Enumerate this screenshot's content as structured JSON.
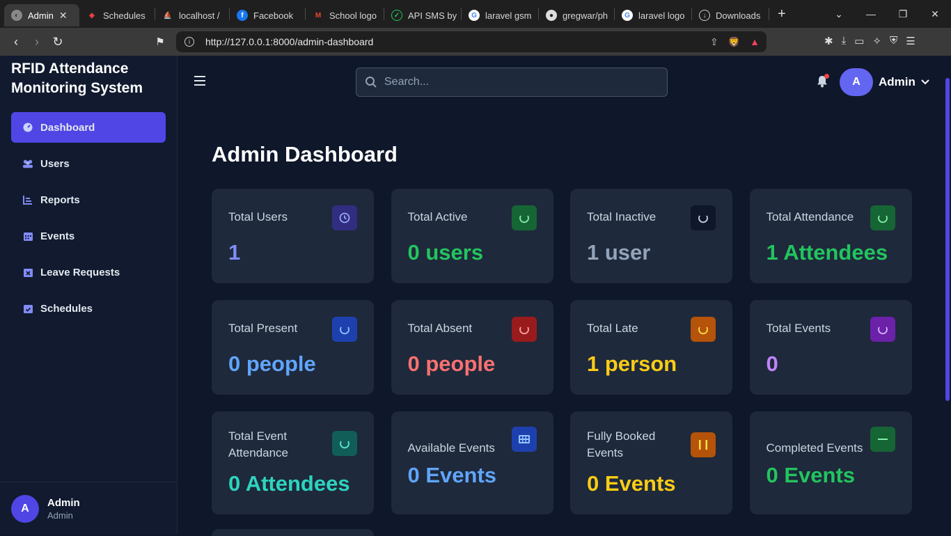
{
  "browser": {
    "tabs": [
      {
        "label": "Admin",
        "active": true
      },
      {
        "label": "Schedules"
      },
      {
        "label": "localhost / "
      },
      {
        "label": "Facebook"
      },
      {
        "label": "School logo"
      },
      {
        "label": "API SMS by"
      },
      {
        "label": "laravel gsm"
      },
      {
        "label": "gregwar/ph"
      },
      {
        "label": "laravel logo"
      },
      {
        "label": "Downloads"
      }
    ],
    "url": "http://127.0.0.1:8000/admin-dashboard"
  },
  "sidebar": {
    "brand": "RFID Attendance Monitoring System",
    "items": [
      {
        "label": "Dashboard",
        "active": true
      },
      {
        "label": "Users"
      },
      {
        "label": "Reports"
      },
      {
        "label": "Events"
      },
      {
        "label": "Leave Requests"
      },
      {
        "label": "Schedules"
      }
    ],
    "footer": {
      "avatar_initial": "A",
      "name": "Admin",
      "role": "Admin"
    }
  },
  "topbar": {
    "search_placeholder": "Search...",
    "user_initial": "A",
    "user_name": "Admin"
  },
  "page": {
    "title": "Admin Dashboard"
  },
  "cards": [
    {
      "label": "Total Users",
      "value": "1",
      "value_color": "#818cf8",
      "icon": "clock-icon",
      "icon_bg": "#312e81",
      "icon_color": "#a5b4fc"
    },
    {
      "label": "Total Active",
      "value": "0 users",
      "value_color": "#22c55e",
      "icon": "spinner-icon",
      "icon_bg": "#166534",
      "icon_color": "#86efac"
    },
    {
      "label": "Total Inactive",
      "value": "1 user",
      "value_color": "#94a3b8",
      "icon": "spinner-icon",
      "icon_bg": "#0f172a",
      "icon_color": "#cbd5e1"
    },
    {
      "label": "Total Attendance",
      "value": "1 Attendees",
      "value_color": "#22c55e",
      "icon": "spinner-icon",
      "icon_bg": "#166534",
      "icon_color": "#86efac"
    },
    {
      "label": "Total Present",
      "value": "0 people",
      "value_color": "#60a5fa",
      "icon": "spinner-icon",
      "icon_bg": "#1e40af",
      "icon_color": "#93c5fd"
    },
    {
      "label": "Total Absent",
      "value": "0 people",
      "value_color": "#f87171",
      "icon": "spinner-icon",
      "icon_bg": "#991b1b",
      "icon_color": "#fca5a5"
    },
    {
      "label": "Total Late",
      "value": "1 person",
      "value_color": "#facc15",
      "icon": "spinner-icon",
      "icon_bg": "#b45309",
      "icon_color": "#fde047"
    },
    {
      "label": "Total Events",
      "value": "0",
      "value_color": "#c084fc",
      "icon": "spinner-icon",
      "icon_bg": "#6b21a8",
      "icon_color": "#d8b4fe"
    },
    {
      "label": "Total Event Attendance",
      "value": "0 Attendees",
      "value_color": "#2dd4bf",
      "icon": "spinner-icon",
      "icon_bg": "#115e59",
      "icon_color": "#5eead4"
    },
    {
      "label": "Available Events",
      "value": "0 Events",
      "value_color": "#60a5fa",
      "icon": "grid-icon",
      "icon_bg": "#1e40af",
      "icon_color": "#93c5fd"
    },
    {
      "label": "Fully Booked Events",
      "value": "0 Events",
      "value_color": "#facc15",
      "icon": "pause-icon",
      "icon_bg": "#b45309",
      "icon_color": "#fde047"
    },
    {
      "label": "Completed Events",
      "value": "0 Events",
      "value_color": "#22c55e",
      "icon": "minus-icon",
      "icon_bg": "#166534",
      "icon_color": "#86efac"
    }
  ]
}
